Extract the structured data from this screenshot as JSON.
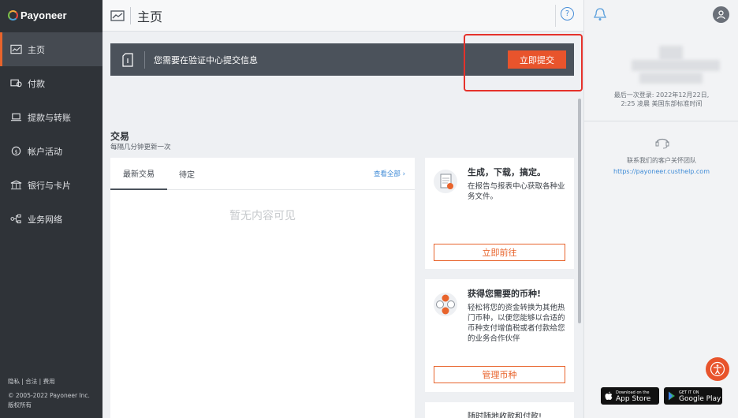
{
  "brand": {
    "name": "Payoneer"
  },
  "sidebar": {
    "items": [
      {
        "label": "主页",
        "icon": "dashboard-icon",
        "active": true
      },
      {
        "label": "付款",
        "icon": "payment-icon",
        "active": false
      },
      {
        "label": "提款与转账",
        "icon": "transfer-icon",
        "active": false
      },
      {
        "label": "帐户活动",
        "icon": "activity-icon",
        "active": false
      },
      {
        "label": "银行与卡片",
        "icon": "bank-icon",
        "active": false
      },
      {
        "label": "业务网络",
        "icon": "network-icon",
        "active": false
      }
    ],
    "footer": {
      "privacy": "隐私",
      "compliance": "合法",
      "fees": "费用",
      "copyright": "© 2005-2022 Payoneer Inc.版权所有"
    }
  },
  "header": {
    "title": "主页",
    "help": "?"
  },
  "banner": {
    "text": "您需要在验证中心提交信息",
    "button": "立即提交"
  },
  "transactions": {
    "title": "交易",
    "subtitle": "每隔几分钟更新一次",
    "tabs": [
      "最新交易",
      "待定"
    ],
    "view_all": "查看全部 ›",
    "empty": "暂无内容可见"
  },
  "cards": [
    {
      "title": "生成，下载，搞定。",
      "text": "在报告与报表中心获取各种业务文件。",
      "button": "立即前往",
      "icon": "report-icon"
    },
    {
      "title": "获得您需要的币种!",
      "text": "轻松将您的资金转换为其他热门币种，以便您能够以合适的币种支付增值税或者付款给您的业务合作伙伴",
      "button": "管理币种",
      "icon": "currency-icon"
    },
    {
      "title": "随时随地收款和付款!",
      "icon": "mobile-icon"
    }
  ],
  "right_panel": {
    "last_login": "最后一次登录: 2022年12月22日,",
    "last_login_time": "2:25 凌晨 美国东部标准时间",
    "contact": "联系我们的客户关怀团队",
    "contact_link": "https://payoneer.custhelp.com",
    "app_store": {
      "small": "Download on the",
      "big": "App Store"
    },
    "google_play": {
      "small": "GET IT ON",
      "big": "Google Play"
    }
  },
  "colors": {
    "accent": "#e8542c",
    "sidebar": "#2f3338",
    "highlight_outline": "#e5322b",
    "link": "#3d8ad6"
  }
}
